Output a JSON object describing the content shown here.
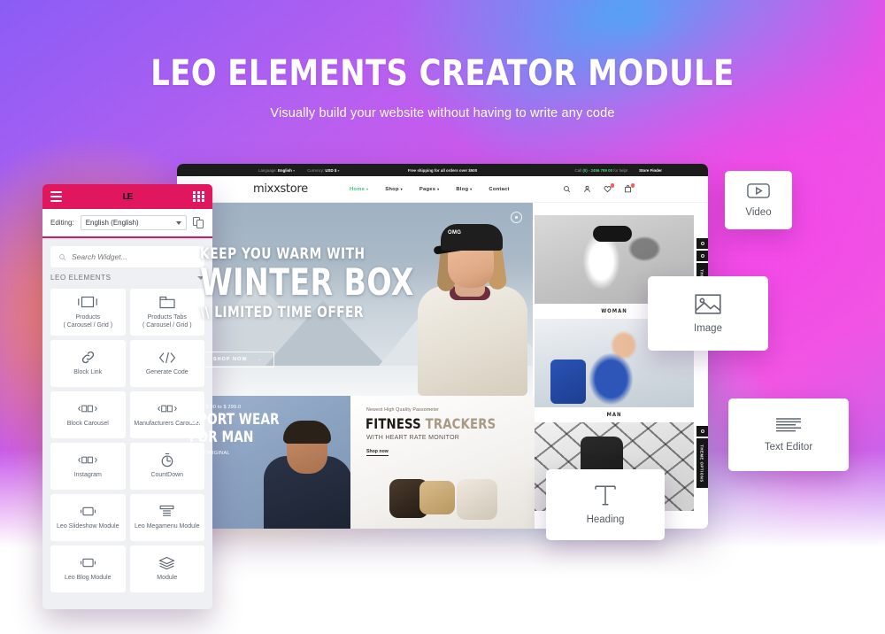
{
  "hero_heading": {
    "title": "LEO ELEMENTS CREATOR MODULE",
    "subtitle": "Visually build your website without having to write any code"
  },
  "leo_panel": {
    "logo": "LE",
    "menu_icon": "hamburger-icon",
    "grid_icon": "grid-icon",
    "editing_label": "Editing:",
    "language_value": "English (English)",
    "copy_icon": "copy-icon",
    "search_placeholder": "Search Widget...",
    "search_value": "",
    "search_icon": "search-icon",
    "section_title": "LEO ELEMENTS",
    "section_chevron": "chevron-down-icon",
    "widgets": [
      {
        "label": "Products\n( Carousel / Grid )",
        "icon": "products-carousel-icon"
      },
      {
        "label": "Products Tabs\n( Carousel / Grid )",
        "icon": "products-tabs-icon"
      },
      {
        "label": "Block Link",
        "icon": "link-icon"
      },
      {
        "label": "Generate Code",
        "icon": "code-icon"
      },
      {
        "label": "Block Carousel",
        "icon": "carousel-icon"
      },
      {
        "label": "Manufacturers Carousel",
        "icon": "carousel-icon"
      },
      {
        "label": "Instagram",
        "icon": "carousel-icon"
      },
      {
        "label": "CountDown",
        "icon": "countdown-icon"
      },
      {
        "label": "Leo Slideshow Module",
        "icon": "slideshow-icon"
      },
      {
        "label": "Leo Megamenu Module",
        "icon": "megamenu-icon"
      },
      {
        "label": "Leo Blog Module",
        "icon": "blog-icon"
      },
      {
        "label": "Module",
        "icon": "layers-icon"
      }
    ]
  },
  "storefront": {
    "topbar": {
      "language_label": "Language:",
      "language_value": "English",
      "currency_label": "Currency:",
      "currency_value": "USD $",
      "shipping_notice": "Free shipping for all orders over $500",
      "call_prefix": "Call",
      "call_number": "(0) - 2456 789 00",
      "call_suffix": "for help!",
      "store_finder": "Store Finder"
    },
    "logo": "mixxstore",
    "nav": [
      {
        "label": "Home",
        "active": true,
        "has_caret": true
      },
      {
        "label": "Shop",
        "active": false,
        "has_caret": true
      },
      {
        "label": "Pages",
        "active": false,
        "has_caret": true
      },
      {
        "label": "Blog",
        "active": false,
        "has_caret": true
      },
      {
        "label": "Contact",
        "active": false,
        "has_caret": false
      }
    ],
    "header_icons": [
      {
        "name": "search-icon",
        "badge": false
      },
      {
        "name": "user-icon",
        "badge": false
      },
      {
        "name": "wishlist-heart-icon",
        "badge": true
      },
      {
        "name": "cart-icon",
        "badge": true
      }
    ],
    "hero": {
      "line1": "KEEP YOU WARM WITH",
      "line2": "WINTER BOX",
      "line3": "\\\\ LIMITED TIME OFFER",
      "button": "SHOP NOW",
      "button_arrow": "→"
    },
    "categories": [
      {
        "label": "WOMAN"
      },
      {
        "label": "MAN"
      }
    ],
    "promo_sport": {
      "price": "from $ 9.90 to $ 299.0",
      "title_line1": "SPORT WEAR",
      "title_line2": "FOR MAN",
      "note": "100% ORIGINAL"
    },
    "promo_fitness": {
      "sub": "Newest High Quality Passometer",
      "title_part1": "FITNESS ",
      "title_part2": "TRACKERS",
      "subtitle": "WITH HEART RATE MONITOR",
      "link": "Shop now"
    },
    "theme_rail_label": "THEME OPTIONS"
  },
  "float_cards": [
    {
      "label": "Video",
      "icon": "video-play-icon"
    },
    {
      "label": "Image",
      "icon": "image-icon"
    },
    {
      "label": "Text Editor",
      "icon": "text-lines-icon"
    },
    {
      "label": "Heading",
      "icon": "heading-t-icon"
    }
  ],
  "colors": {
    "accent_pink": "#e0165f",
    "nav_active_green": "#45c07f",
    "badge_red": "#f4605f",
    "topbar_black": "#1c1c1c"
  }
}
